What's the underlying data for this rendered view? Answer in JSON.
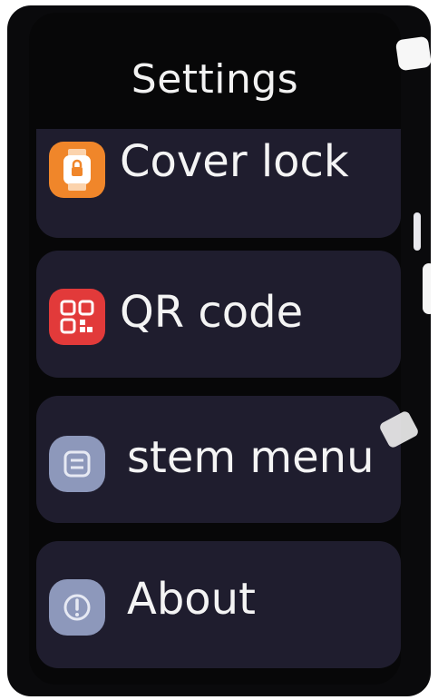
{
  "screen": {
    "title": "Settings"
  },
  "menu": {
    "items": [
      {
        "label": "Cover lock",
        "icon": "watch-lock-icon",
        "icon_color": "#f0862a"
      },
      {
        "label": "QR code",
        "icon": "qr-code-icon",
        "icon_color": "#e23a3a"
      },
      {
        "label": "stem menu",
        "icon": "system-menu-icon",
        "icon_color": "#8d98bb"
      },
      {
        "label": "About",
        "icon": "info-icon",
        "icon_color": "#8d98bb"
      }
    ]
  },
  "colors": {
    "background": "#070708",
    "row_background": "#1f1d2e",
    "text": "#f4f4f4"
  }
}
